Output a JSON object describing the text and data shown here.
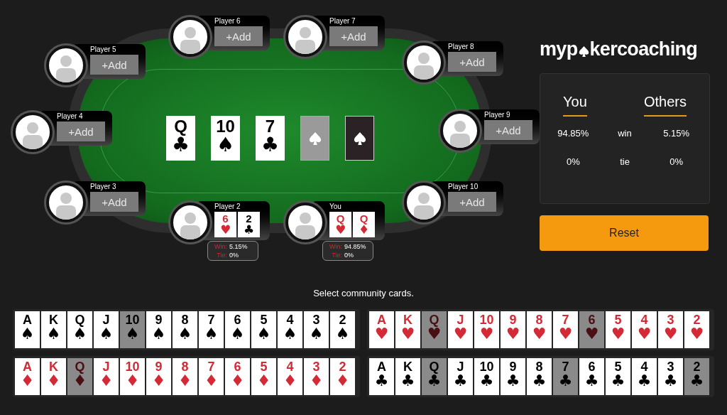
{
  "table": {
    "community": [
      {
        "kind": "card",
        "rank": "Q",
        "suit": "♣",
        "color": "#000000"
      },
      {
        "kind": "card",
        "rank": "10",
        "suit": "♠",
        "color": "#000000"
      },
      {
        "kind": "card",
        "rank": "7",
        "suit": "♣",
        "color": "#000000"
      },
      {
        "kind": "slot",
        "selected": true
      },
      {
        "kind": "back"
      }
    ]
  },
  "seats": [
    {
      "kind": "empty",
      "name": "Player 6",
      "add_label": "+Add"
    },
    {
      "kind": "empty",
      "name": "Player 7",
      "add_label": "+Add"
    },
    {
      "kind": "empty",
      "name": "Player 5",
      "add_label": "+Add"
    },
    {
      "kind": "empty",
      "name": "Player 8",
      "add_label": "+Add"
    },
    {
      "kind": "empty",
      "name": "Player 4",
      "add_label": "+Add"
    },
    {
      "kind": "empty",
      "name": "Player 9",
      "add_label": "+Add"
    },
    {
      "kind": "empty",
      "name": "Player 3",
      "add_label": "+Add"
    },
    {
      "kind": "empty",
      "name": "Player 10",
      "add_label": "+Add"
    },
    {
      "kind": "hand",
      "name": "Player 2",
      "cards": [
        {
          "rank": "6",
          "suit": "♥",
          "color": "#d42a35"
        },
        {
          "rank": "2",
          "suit": "♣",
          "color": "#000000"
        }
      ],
      "stats": [
        {
          "label": "Win:",
          "value": "5.15%"
        },
        {
          "label": "Tie:",
          "value": "0%"
        }
      ]
    },
    {
      "kind": "hand",
      "name": "You",
      "cards": [
        {
          "rank": "Q",
          "suit": "♥",
          "color": "#d42a35"
        },
        {
          "rank": "Q",
          "suit": "♦",
          "color": "#d42a35"
        }
      ],
      "stats": [
        {
          "label": "Win:",
          "value": "94.85%"
        },
        {
          "label": "Tie:",
          "value": "0%"
        }
      ]
    }
  ],
  "logo": {
    "before": "myp",
    "after": "kercoaching"
  },
  "summary": {
    "headers": [
      "You",
      "Others"
    ],
    "rows": [
      {
        "you": "94.85%",
        "label": "win",
        "others": "5.15%"
      },
      {
        "you": "0%",
        "label": "tie",
        "others": "0%"
      }
    ]
  },
  "reset_button": "Reset",
  "prompt": "Select community cards.",
  "picker": [
    {
      "suit": "♠",
      "color": "#000000",
      "cards": [
        {
          "rank": "A",
          "disabled": false
        },
        {
          "rank": "K",
          "disabled": false
        },
        {
          "rank": "Q",
          "disabled": false
        },
        {
          "rank": "J",
          "disabled": false
        },
        {
          "rank": "10",
          "disabled": true
        },
        {
          "rank": "9",
          "disabled": false
        },
        {
          "rank": "8",
          "disabled": false
        },
        {
          "rank": "7",
          "disabled": false
        },
        {
          "rank": "6",
          "disabled": false
        },
        {
          "rank": "5",
          "disabled": false
        },
        {
          "rank": "4",
          "disabled": false
        },
        {
          "rank": "3",
          "disabled": false
        },
        {
          "rank": "2",
          "disabled": false
        }
      ]
    },
    {
      "suit": "♥",
      "color": "#d42a35",
      "cards": [
        {
          "rank": "A",
          "disabled": false
        },
        {
          "rank": "K",
          "disabled": false
        },
        {
          "rank": "Q",
          "disabled": true
        },
        {
          "rank": "J",
          "disabled": false
        },
        {
          "rank": "10",
          "disabled": false
        },
        {
          "rank": "9",
          "disabled": false
        },
        {
          "rank": "8",
          "disabled": false
        },
        {
          "rank": "7",
          "disabled": false
        },
        {
          "rank": "6",
          "disabled": true
        },
        {
          "rank": "5",
          "disabled": false
        },
        {
          "rank": "4",
          "disabled": false
        },
        {
          "rank": "3",
          "disabled": false
        },
        {
          "rank": "2",
          "disabled": false
        }
      ]
    },
    {
      "suit": "♦",
      "color": "#d42a35",
      "cards": [
        {
          "rank": "A",
          "disabled": false
        },
        {
          "rank": "K",
          "disabled": false
        },
        {
          "rank": "Q",
          "disabled": true
        },
        {
          "rank": "J",
          "disabled": false
        },
        {
          "rank": "10",
          "disabled": false
        },
        {
          "rank": "9",
          "disabled": false
        },
        {
          "rank": "8",
          "disabled": false
        },
        {
          "rank": "7",
          "disabled": false
        },
        {
          "rank": "6",
          "disabled": false
        },
        {
          "rank": "5",
          "disabled": false
        },
        {
          "rank": "4",
          "disabled": false
        },
        {
          "rank": "3",
          "disabled": false
        },
        {
          "rank": "2",
          "disabled": false
        }
      ]
    },
    {
      "suit": "♣",
      "color": "#000000",
      "cards": [
        {
          "rank": "A",
          "disabled": false
        },
        {
          "rank": "K",
          "disabled": false
        },
        {
          "rank": "Q",
          "disabled": true
        },
        {
          "rank": "J",
          "disabled": false
        },
        {
          "rank": "10",
          "disabled": false
        },
        {
          "rank": "9",
          "disabled": false
        },
        {
          "rank": "8",
          "disabled": false
        },
        {
          "rank": "7",
          "disabled": true
        },
        {
          "rank": "6",
          "disabled": false
        },
        {
          "rank": "5",
          "disabled": false
        },
        {
          "rank": "4",
          "disabled": false
        },
        {
          "rank": "3",
          "disabled": false
        },
        {
          "rank": "2",
          "disabled": true
        }
      ]
    }
  ]
}
